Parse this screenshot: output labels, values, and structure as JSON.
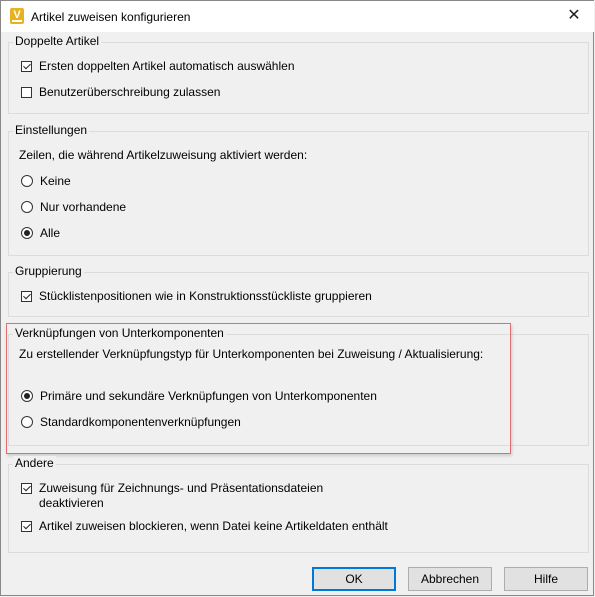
{
  "window": {
    "title": "Artikel zuweisen konfigurieren",
    "icon_letter": "V",
    "close_glyph": "✕"
  },
  "groups": {
    "doppelte": {
      "legend": "Doppelte Artikel",
      "items": [
        {
          "label": "Ersten doppelten Artikel automatisch auswählen",
          "checked": true
        },
        {
          "label": "Benutzerüberschreibung zulassen",
          "checked": false
        }
      ]
    },
    "einstellungen": {
      "legend": "Einstellungen",
      "description": "Zeilen, die während Artikelzuweisung aktiviert werden:",
      "options": [
        {
          "label": "Keine",
          "selected": false
        },
        {
          "label": "Nur vorhandene",
          "selected": false
        },
        {
          "label": "Alle",
          "selected": true
        }
      ]
    },
    "gruppierung": {
      "legend": "Gruppierung",
      "items": [
        {
          "label": "Stücklistenpositionen wie in Konstruktionsstückliste gruppieren",
          "checked": true
        }
      ]
    },
    "verknuepfungen": {
      "legend": "Verknüpfungen von Unterkomponenten",
      "description": "Zu erstellender Verknüpfungstyp für Unterkomponenten bei Zuweisung / Aktualisierung:",
      "options": [
        {
          "label": "Primäre und sekundäre Verknüpfungen von Unterkomponenten",
          "selected": true
        },
        {
          "label": "Standardkomponentenverknüpfungen",
          "selected": false
        }
      ]
    },
    "andere": {
      "legend": "Andere",
      "items": [
        {
          "label_line1": "Zuweisung für Zeichnungs- und Präsentationsdateien",
          "label_line2": "deaktivieren",
          "checked": true
        },
        {
          "label": "Artikel zuweisen blockieren, wenn Datei keine Artikeldaten enthält",
          "checked": true
        }
      ]
    }
  },
  "buttons": {
    "ok": "OK",
    "cancel": "Abbrechen",
    "help": "Hilfe"
  },
  "colors": {
    "accent": "#0078d7",
    "highlight_border": "#e07070",
    "icon": "#e6b31e"
  }
}
